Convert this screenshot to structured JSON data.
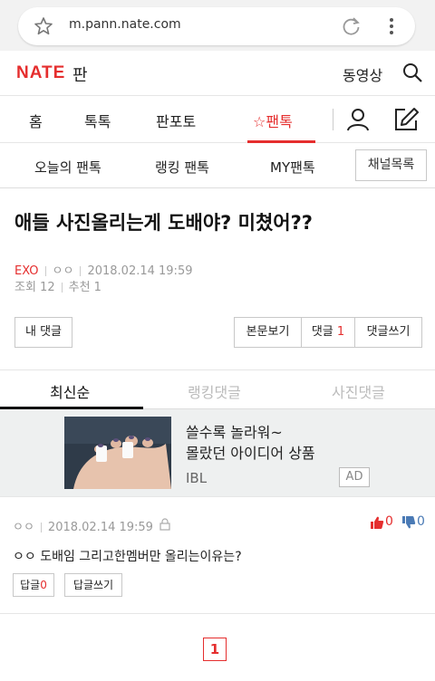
{
  "browser": {
    "url": "m.pann.nate.com"
  },
  "header": {
    "logo": "NATE",
    "logo_suffix": "판",
    "video_label": "동영상"
  },
  "main_nav": {
    "items": [
      {
        "label": "홈"
      },
      {
        "label": "톡톡"
      },
      {
        "label": "판포토"
      },
      {
        "label": "☆팬톡",
        "active": true
      }
    ]
  },
  "sub_nav": {
    "items": [
      {
        "label": "오늘의 팬톡"
      },
      {
        "label": "랭킹 팬톡"
      },
      {
        "label": "MY팬톡"
      }
    ],
    "channel_button": "채널목록"
  },
  "post": {
    "title": "애들 사진올리는게 도배야? 미쳤어??",
    "category": "EXO",
    "author": "ㅇㅇ",
    "date": "2018.02.14 19:59",
    "views": "조회 12",
    "recommends": "추천 1"
  },
  "comment_bar": {
    "my_comments": "내 댓글",
    "view_body": "본문보기",
    "comments_label": "댓글",
    "comments_count": "1",
    "write_comment": "댓글쓰기"
  },
  "tabs": [
    {
      "label": "최신순",
      "active": true
    },
    {
      "label": "랭킹댓글"
    },
    {
      "label": "사진댓글"
    }
  ],
  "ad": {
    "line1": "쓸수록 놀라워~",
    "line2": "몰랐던 아이디어 상품",
    "brand": "IBL",
    "badge": "AD"
  },
  "comments": [
    {
      "author": "ㅇㅇ",
      "date": "2018.02.14 19:59",
      "up": "0",
      "down": "0",
      "text": "ㅇㅇ 도배임 그리고한멤버만 올리는이유는?",
      "reply_label": "답글",
      "reply_count": "0",
      "write_reply": "답글쓰기"
    }
  ],
  "pagination": {
    "current": "1"
  },
  "colors": {
    "accent": "#e52e2e",
    "down": "#4a7ab5"
  },
  "icons": [
    "star-icon",
    "reload-icon",
    "more-icon",
    "search-icon",
    "person-icon",
    "edit-icon",
    "lock-icon",
    "thumb-up-icon",
    "thumb-down-icon"
  ]
}
